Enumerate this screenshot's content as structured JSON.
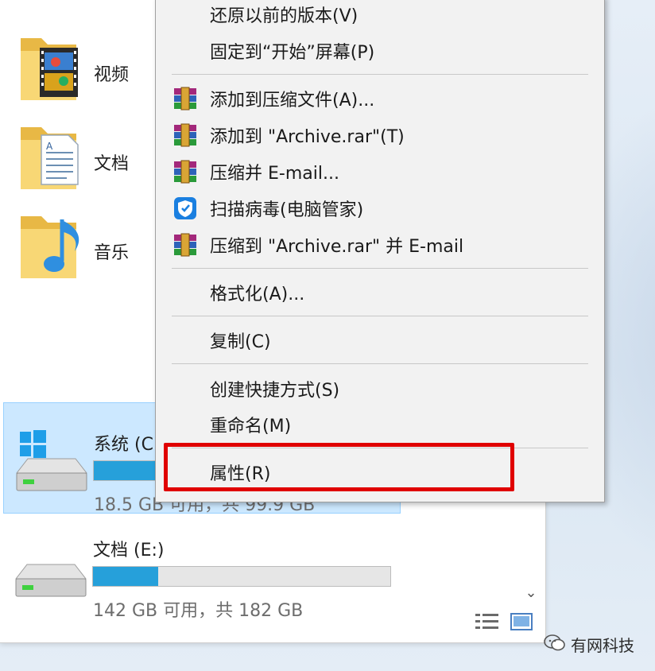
{
  "explorer": {
    "folders": [
      {
        "label": "视频",
        "icon": "video-folder-icon"
      },
      {
        "label": "文档",
        "icon": "documents-folder-icon"
      },
      {
        "label": "音乐",
        "icon": "music-folder-icon"
      }
    ],
    "drives": [
      {
        "name": "系统 (C",
        "info": "18.5 GB 可用，共 99.9 GB",
        "used_fraction": 0.8,
        "selected": true,
        "icon": "windows-drive-icon"
      },
      {
        "name": "文档 (E:)",
        "info": "142 GB 可用，共 182 GB",
        "used_fraction": 0.22,
        "selected": false,
        "icon": "drive-icon"
      }
    ],
    "scroll_down_glyph": "⌄"
  },
  "context_menu": {
    "items": [
      {
        "label": "还原以前的版本(V)",
        "icon": ""
      },
      {
        "label": "固定到“开始”屏幕(P)",
        "icon": ""
      },
      {
        "label": "添加到压缩文件(A)...",
        "icon": "winrar-icon"
      },
      {
        "label": "添加到 \"Archive.rar\"(T)",
        "icon": "winrar-icon"
      },
      {
        "label": "压缩并 E-mail...",
        "icon": "winrar-icon"
      },
      {
        "label": "扫描病毒(电脑管家)",
        "icon": "shield-icon"
      },
      {
        "label": "压缩到 \"Archive.rar\" 并 E-mail",
        "icon": "winrar-icon"
      },
      {
        "label": "格式化(A)...",
        "icon": ""
      },
      {
        "label": "复制(C)",
        "icon": ""
      },
      {
        "label": "创建快捷方式(S)",
        "icon": ""
      },
      {
        "label": "重命名(M)",
        "icon": ""
      },
      {
        "label": "属性(R)",
        "icon": ""
      }
    ],
    "highlight_color": "#e00000"
  },
  "watermark": {
    "text": "有网科技"
  },
  "colors": {
    "selection": "#cce8ff",
    "bar_fill": "#26a0da",
    "menu_bg": "#f2f2f2"
  }
}
